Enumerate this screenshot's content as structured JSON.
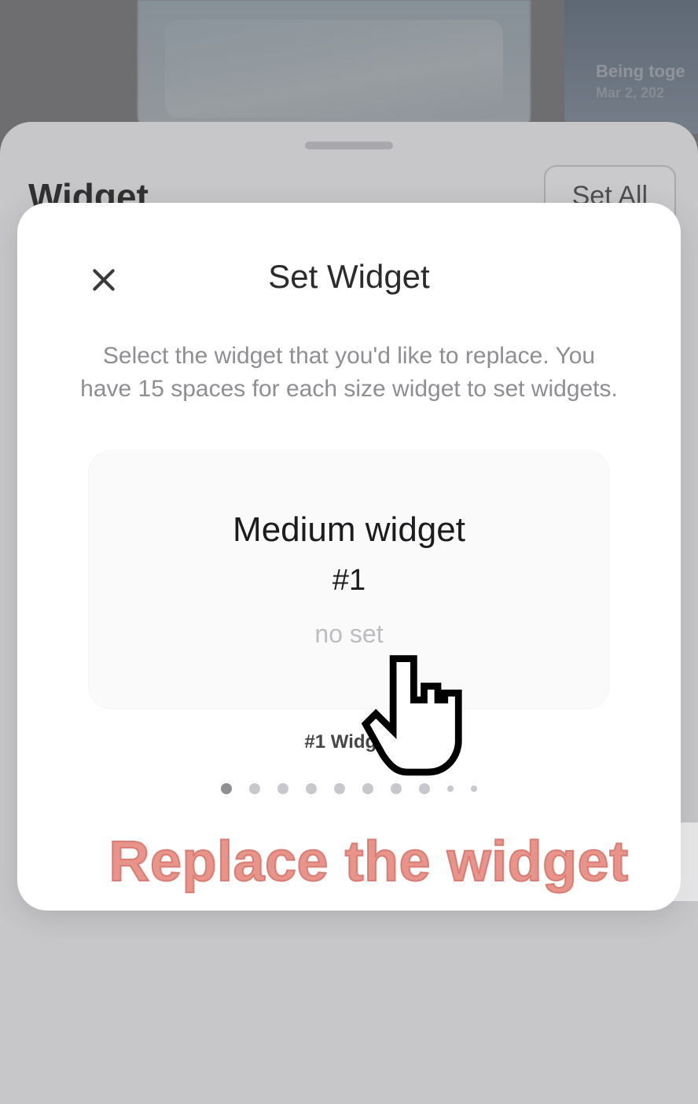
{
  "background": {
    "preview_label1": "Being toge",
    "preview_label2": "Mar 2, 202"
  },
  "sheet": {
    "title": "Widget",
    "set_all_label": "Set All"
  },
  "modal": {
    "title": "Set Widget",
    "description": "Select the widget that you'd like to replace. You have 15 spaces for each size widget to set widgets.",
    "card": {
      "size_label": "Medium widget",
      "number_label": "#1",
      "status": "no set"
    },
    "caption": "#1 Widget",
    "page_count": 10,
    "active_page": 0
  },
  "caption_overlay": "Replace the widget"
}
